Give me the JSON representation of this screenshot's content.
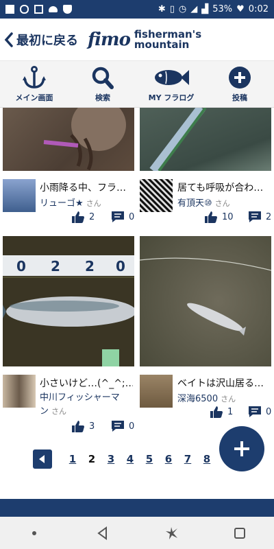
{
  "statusbar": {
    "battery": "53%",
    "time": "0:02"
  },
  "header": {
    "back_label": "最初に戻る",
    "logo_script": "fimo",
    "logo_line1": "fisherman's",
    "logo_line2": "mountain"
  },
  "nav": [
    {
      "label": "メイン画面",
      "icon": "anchor-icon"
    },
    {
      "label": "検索",
      "icon": "search-icon"
    },
    {
      "label": "MY フラログ",
      "icon": "fish-icon"
    },
    {
      "label": "投稿",
      "icon": "plus-circle-icon"
    }
  ],
  "posts": [
    {
      "title": "小雨降る中、フラ…",
      "author": "リューゴ★",
      "san": "さん",
      "likes": "2",
      "comments": "0"
    },
    {
      "title": "居ても呼吸が合わ…",
      "author": "有頂天⑩",
      "san": "さん",
      "likes": "10",
      "comments": "2"
    },
    {
      "title": "小さいけど…(^_^;…",
      "author_line1": "中川フィッシャーマ",
      "author_line2": "ン",
      "san": "さん",
      "likes": "3",
      "comments": "0"
    },
    {
      "title": "ベイトは沢山居る…",
      "author": "深海6500",
      "san": "さん",
      "likes": "1",
      "comments": "0"
    }
  ],
  "pagination": {
    "pages": [
      "1",
      "2",
      "3",
      "4",
      "5",
      "6",
      "7",
      "8"
    ],
    "current": "2"
  },
  "colors": {
    "brand": "#1d3d6e"
  }
}
